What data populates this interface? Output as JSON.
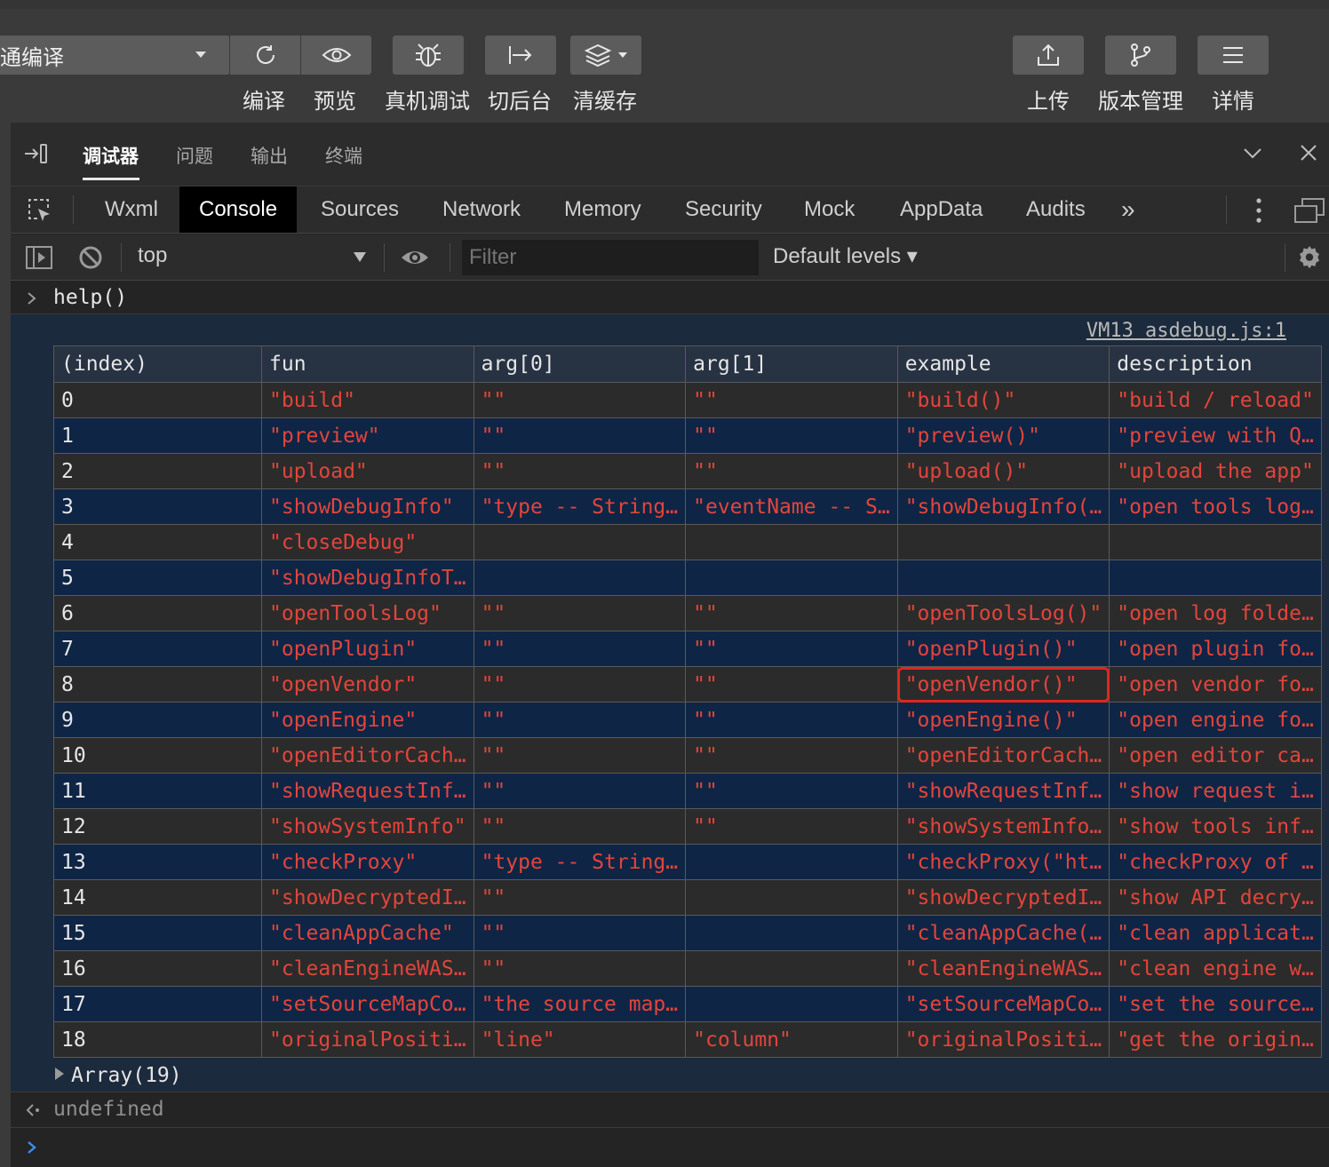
{
  "toolbar": {
    "compile_mode": "通编译",
    "buttons": [
      {
        "label": "编译",
        "icon": "refresh-icon"
      },
      {
        "label": "预览",
        "icon": "eye-icon"
      },
      {
        "label": "真机调试",
        "icon": "bug-icon"
      },
      {
        "label": "切后台",
        "icon": "switch-background-icon"
      },
      {
        "label": "清缓存",
        "icon": "layers-icon"
      },
      {
        "label": "上传",
        "icon": "upload-icon"
      },
      {
        "label": "版本管理",
        "icon": "branch-icon"
      },
      {
        "label": "详情",
        "icon": "menu-icon"
      }
    ]
  },
  "devtools": {
    "main_tabs": [
      "调试器",
      "问题",
      "输出",
      "终端"
    ],
    "active_main_tab": "调试器",
    "panel_tabs": [
      "Wxml",
      "Console",
      "Sources",
      "Network",
      "Memory",
      "Security",
      "Mock",
      "AppData",
      "Audits"
    ],
    "active_panel_tab": "Console",
    "more_tabs": "»"
  },
  "console_toolbar": {
    "context": "top",
    "filter_placeholder": "Filter",
    "levels": "Default levels ▾"
  },
  "console": {
    "input": "help()",
    "source_link": "VM13 asdebug.js:1",
    "table": {
      "headers": [
        "(index)",
        "fun",
        "arg[0]",
        "arg[1]",
        "example",
        "description"
      ],
      "rows": [
        [
          "0",
          "\"build\"",
          "\"\"",
          "\"\"",
          "\"build()\"",
          "\"build / reload\""
        ],
        [
          "1",
          "\"preview\"",
          "\"\"",
          "\"\"",
          "\"preview()\"",
          "\"preview with Q…"
        ],
        [
          "2",
          "\"upload\"",
          "\"\"",
          "\"\"",
          "\"upload()\"",
          "\"upload the app\""
        ],
        [
          "3",
          "\"showDebugInfo\"",
          "\"type -- String…",
          "\"eventName -- S…",
          "\"showDebugInfo(…",
          "\"open tools log…"
        ],
        [
          "4",
          "\"closeDebug\"",
          "",
          "",
          "",
          ""
        ],
        [
          "5",
          "\"showDebugInfoT…",
          "",
          "",
          "",
          ""
        ],
        [
          "6",
          "\"openToolsLog\"",
          "\"\"",
          "\"\"",
          "\"openToolsLog()\"",
          "\"open log folde…"
        ],
        [
          "7",
          "\"openPlugin\"",
          "\"\"",
          "\"\"",
          "\"openPlugin()\"",
          "\"open plugin fo…"
        ],
        [
          "8",
          "\"openVendor\"",
          "\"\"",
          "\"\"",
          "\"openVendor()\"",
          "\"open vendor fo…"
        ],
        [
          "9",
          "\"openEngine\"",
          "\"\"",
          "\"\"",
          "\"openEngine()\"",
          "\"open engine fo…"
        ],
        [
          "10",
          "\"openEditorCach…",
          "\"\"",
          "\"\"",
          "\"openEditorCach…",
          "\"open editor ca…"
        ],
        [
          "11",
          "\"showRequestInf…",
          "\"\"",
          "\"\"",
          "\"showRequestInf…",
          "\"show request i…"
        ],
        [
          "12",
          "\"showSystemInfo\"",
          "\"\"",
          "\"\"",
          "\"showSystemInfo…",
          "\"show tools inf…"
        ],
        [
          "13",
          "\"checkProxy\"",
          "\"type -- String…",
          "",
          "\"checkProxy(\"ht…",
          "\"checkProxy of …"
        ],
        [
          "14",
          "\"showDecryptedI…",
          "\"\"",
          "",
          "\"showDecryptedI…",
          "\"show API decry…"
        ],
        [
          "15",
          "\"cleanAppCache\"",
          "\"\"",
          "",
          "\"cleanAppCache(…",
          "\"clean applicat…"
        ],
        [
          "16",
          "\"cleanEngineWAS…",
          "\"\"",
          "",
          "\"cleanEngineWAS…",
          "\"clean engine w…"
        ],
        [
          "17",
          "\"setSourceMapCo…",
          "\"the source map…",
          "",
          "\"setSourceMapCo…",
          "\"set the source…"
        ],
        [
          "18",
          "\"originalPositi…",
          "\"line\"",
          "\"column\"",
          "\"originalPositi…",
          "\"get the origin…"
        ]
      ],
      "highlighted_cell": "\"openVendor()\""
    },
    "array_summary": "Array(19)",
    "result": "undefined"
  },
  "colors": {
    "string_value": "#e2453c",
    "highlight_box": "#e0261f",
    "odd_row": "#0f2545",
    "even_row": "#2b2b2b"
  }
}
